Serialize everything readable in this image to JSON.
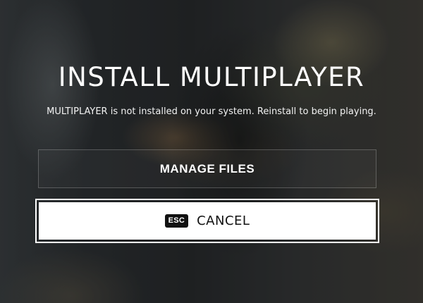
{
  "dialog": {
    "title": "INSTALL MULTIPLAYER",
    "message": "MULTIPLAYER is not installed on your system. Reinstall to begin playing."
  },
  "buttons": {
    "manage_files": {
      "label": "MANAGE FILES"
    },
    "cancel": {
      "key_hint": "ESC",
      "label": "CANCEL"
    }
  },
  "colors": {
    "text": "#ffffff",
    "focused_button_bg": "#ffffff",
    "focused_button_text": "#111111",
    "key_hint_bg": "#111111"
  }
}
